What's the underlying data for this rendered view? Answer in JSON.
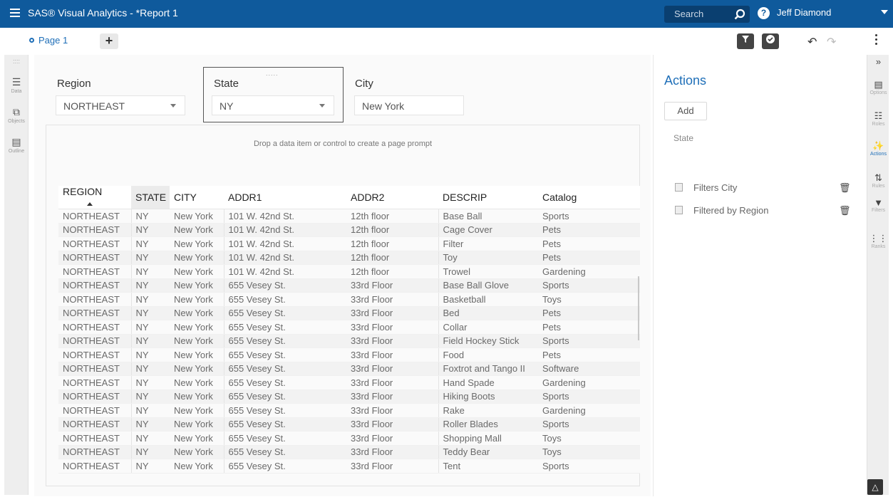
{
  "app": {
    "title": "SAS® Visual Analytics - *Report 1",
    "search_placeholder": "Search",
    "help": "?",
    "user": "Jeff Diamond"
  },
  "toolbar": {
    "page_tab": "Page 1",
    "add_page": "+"
  },
  "left_rail": [
    {
      "icon": "database-icon",
      "label": "Data"
    },
    {
      "icon": "objects-icon",
      "label": "Objects"
    },
    {
      "icon": "outline-icon",
      "label": "Outline"
    }
  ],
  "prompts": {
    "region_label": "Region",
    "region_value": "NORTHEAST",
    "state_label": "State",
    "state_value": "NY",
    "city_label": "City",
    "city_value": "New York",
    "drop_text": "Drop a data item or control to create a page prompt"
  },
  "table": {
    "columns": [
      "REGION",
      "STATE",
      "CITY",
      "ADDR1",
      "ADDR2",
      "DESCRIP",
      "Catalog"
    ],
    "rows": [
      [
        "NORTHEAST",
        "NY",
        "New York",
        "101 W. 42nd St.",
        "12th floor",
        "Base Ball",
        "Sports"
      ],
      [
        "NORTHEAST",
        "NY",
        "New York",
        "101 W. 42nd St.",
        "12th floor",
        "Cage Cover",
        "Pets"
      ],
      [
        "NORTHEAST",
        "NY",
        "New York",
        "101 W. 42nd St.",
        "12th floor",
        "Filter",
        "Pets"
      ],
      [
        "NORTHEAST",
        "NY",
        "New York",
        "101 W. 42nd St.",
        "12th floor",
        "Toy",
        "Pets"
      ],
      [
        "NORTHEAST",
        "NY",
        "New York",
        "101 W. 42nd St.",
        "12th floor",
        "Trowel",
        "Gardening"
      ],
      [
        "NORTHEAST",
        "NY",
        "New York",
        "655 Vesey St.",
        "33rd Floor",
        "Base Ball Glove",
        "Sports"
      ],
      [
        "NORTHEAST",
        "NY",
        "New York",
        "655 Vesey St.",
        "33rd Floor",
        "Basketball",
        "Toys"
      ],
      [
        "NORTHEAST",
        "NY",
        "New York",
        "655 Vesey St.",
        "33rd Floor",
        "Bed",
        "Pets"
      ],
      [
        "NORTHEAST",
        "NY",
        "New York",
        "655 Vesey St.",
        "33rd Floor",
        "Collar",
        "Pets"
      ],
      [
        "NORTHEAST",
        "NY",
        "New York",
        "655 Vesey St.",
        "33rd Floor",
        "Field Hockey Stick",
        "Sports"
      ],
      [
        "NORTHEAST",
        "NY",
        "New York",
        "655 Vesey St.",
        "33rd Floor",
        "Food",
        "Pets"
      ],
      [
        "NORTHEAST",
        "NY",
        "New York",
        "655 Vesey St.",
        "33rd Floor",
        "Foxtrot and Tango II",
        "Software"
      ],
      [
        "NORTHEAST",
        "NY",
        "New York",
        "655 Vesey St.",
        "33rd Floor",
        "Hand Spade",
        "Gardening"
      ],
      [
        "NORTHEAST",
        "NY",
        "New York",
        "655 Vesey St.",
        "33rd Floor",
        "Hiking Boots",
        "Sports"
      ],
      [
        "NORTHEAST",
        "NY",
        "New York",
        "655 Vesey St.",
        "33rd Floor",
        "Rake",
        "Gardening"
      ],
      [
        "NORTHEAST",
        "NY",
        "New York",
        "655 Vesey St.",
        "33rd Floor",
        "Roller Blades",
        "Sports"
      ],
      [
        "NORTHEAST",
        "NY",
        "New York",
        "655 Vesey St.",
        "33rd Floor",
        "Shopping Mall",
        "Toys"
      ],
      [
        "NORTHEAST",
        "NY",
        "New York",
        "655 Vesey St.",
        "33rd Floor",
        "Teddy Bear",
        "Toys"
      ],
      [
        "NORTHEAST",
        "NY",
        "New York",
        "655 Vesey St.",
        "33rd Floor",
        "Tent",
        "Sports"
      ]
    ]
  },
  "actions": {
    "title": "Actions",
    "add_label": "Add",
    "section": "State",
    "items": [
      "Filters City",
      "Filtered by Region"
    ]
  },
  "right_rail": [
    {
      "icon": "options-icon",
      "label": "Options"
    },
    {
      "icon": "roles-icon",
      "label": "Roles"
    },
    {
      "icon": "actions-icon",
      "label": "Actions"
    },
    {
      "icon": "rules-icon",
      "label": "Rules"
    },
    {
      "icon": "filters-icon",
      "label": "Filters"
    },
    {
      "icon": "ranks-icon",
      "label": "Ranks"
    }
  ],
  "colors": {
    "topbar": "#0f5a9c",
    "accent": "#1f6fb8"
  }
}
